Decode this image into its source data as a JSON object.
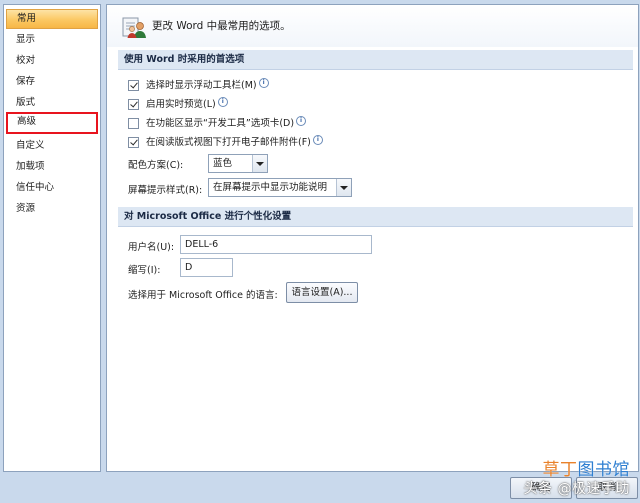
{
  "sidebar": {
    "items": [
      {
        "label": "常用",
        "state": "selected"
      },
      {
        "label": "显示"
      },
      {
        "label": "校对"
      },
      {
        "label": "保存"
      },
      {
        "label": "版式"
      },
      {
        "label": "高级",
        "state": "highlighted"
      },
      {
        "label": "自定义"
      },
      {
        "label": "加载项"
      },
      {
        "label": "信任中心"
      },
      {
        "label": "资源"
      }
    ]
  },
  "header": {
    "title": "更改 Word 中最常用的选项。",
    "icon": "settings-people-icon"
  },
  "section1": {
    "title": "使用 Word 时采用的首选项",
    "options": [
      {
        "label": "选择时显示浮动工具栏(M)",
        "checked": true,
        "info": true
      },
      {
        "label": "启用实时预览(L)",
        "checked": true,
        "info": true
      },
      {
        "label": "在功能区显示“开发工具”选项卡(D)",
        "checked": false,
        "info": true
      },
      {
        "label": "在阅读版式视图下打开电子邮件附件(F)",
        "checked": true,
        "info": true
      }
    ],
    "color_scheme": {
      "label": "配色方案(C):",
      "value": "蓝色"
    },
    "tooltip_style": {
      "label": "屏幕提示样式(R):",
      "value": "在屏幕提示中显示功能说明"
    }
  },
  "section2": {
    "title": "对 Microsoft Office 进行个性化设置",
    "username": {
      "label": "用户名(U):",
      "value": "DELL-6"
    },
    "initials": {
      "label": "缩写(I):",
      "value": "D"
    },
    "language": {
      "label": "选择用于 Microsoft Office 的语言:",
      "button": "语言设置(A)..."
    }
  },
  "footer": {
    "ok": "确定",
    "cancel": "取消"
  },
  "watermark": {
    "source": "头条 @极速手助",
    "logo_part1": "草丁",
    "logo_part2": "图书馆"
  }
}
